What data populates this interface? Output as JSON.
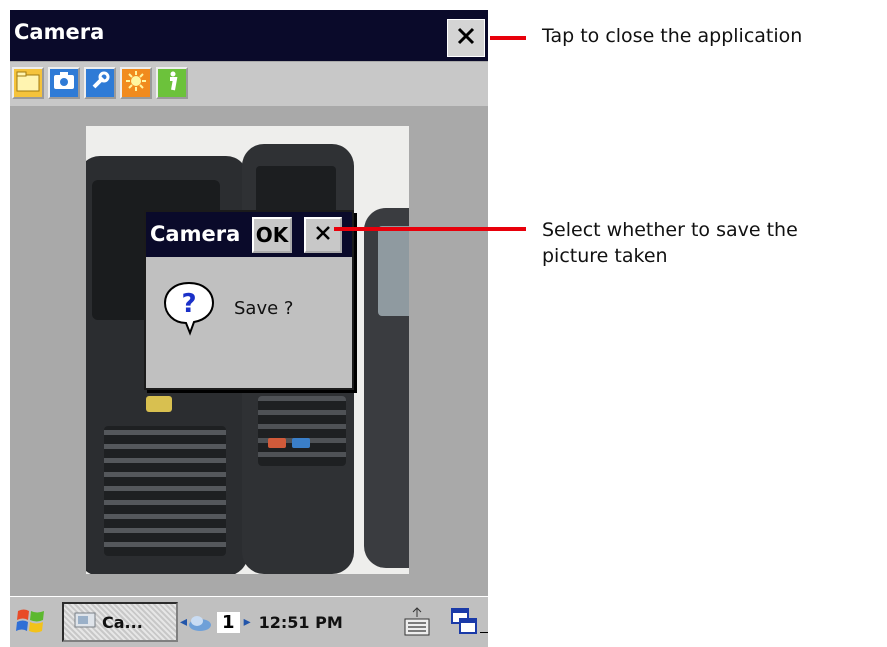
{
  "app": {
    "title": "Camera",
    "close_symbol": "✕"
  },
  "toolbar": {
    "buttons": [
      {
        "name": "open-folder-button",
        "icon": "folder-icon",
        "color": "#f5c33b"
      },
      {
        "name": "capture-button",
        "icon": "camera-icon",
        "color": "#2f7bd6"
      },
      {
        "name": "settings-button",
        "icon": "wrench-icon",
        "color": "#2f7bd6"
      },
      {
        "name": "brightness-button",
        "icon": "sun-icon",
        "color": "#f18b1e"
      },
      {
        "name": "info-button",
        "icon": "info-icon",
        "color": "#6cc23b"
      }
    ]
  },
  "dialog": {
    "title": "Camera",
    "ok_label": "OK",
    "close_symbol": "✕",
    "icon": "question-icon",
    "message": "Save ?"
  },
  "taskbar": {
    "task_label": "Ca...",
    "page_number": "1",
    "clock": "12:51 PM"
  },
  "callouts": {
    "close": "Tap to close the application",
    "save_line1": "Select whether to save the",
    "save_line2": "picture taken"
  },
  "colors": {
    "accent": "#e8000b",
    "titlebar": "#0a0a2a",
    "screen": "#a9a9a9"
  }
}
